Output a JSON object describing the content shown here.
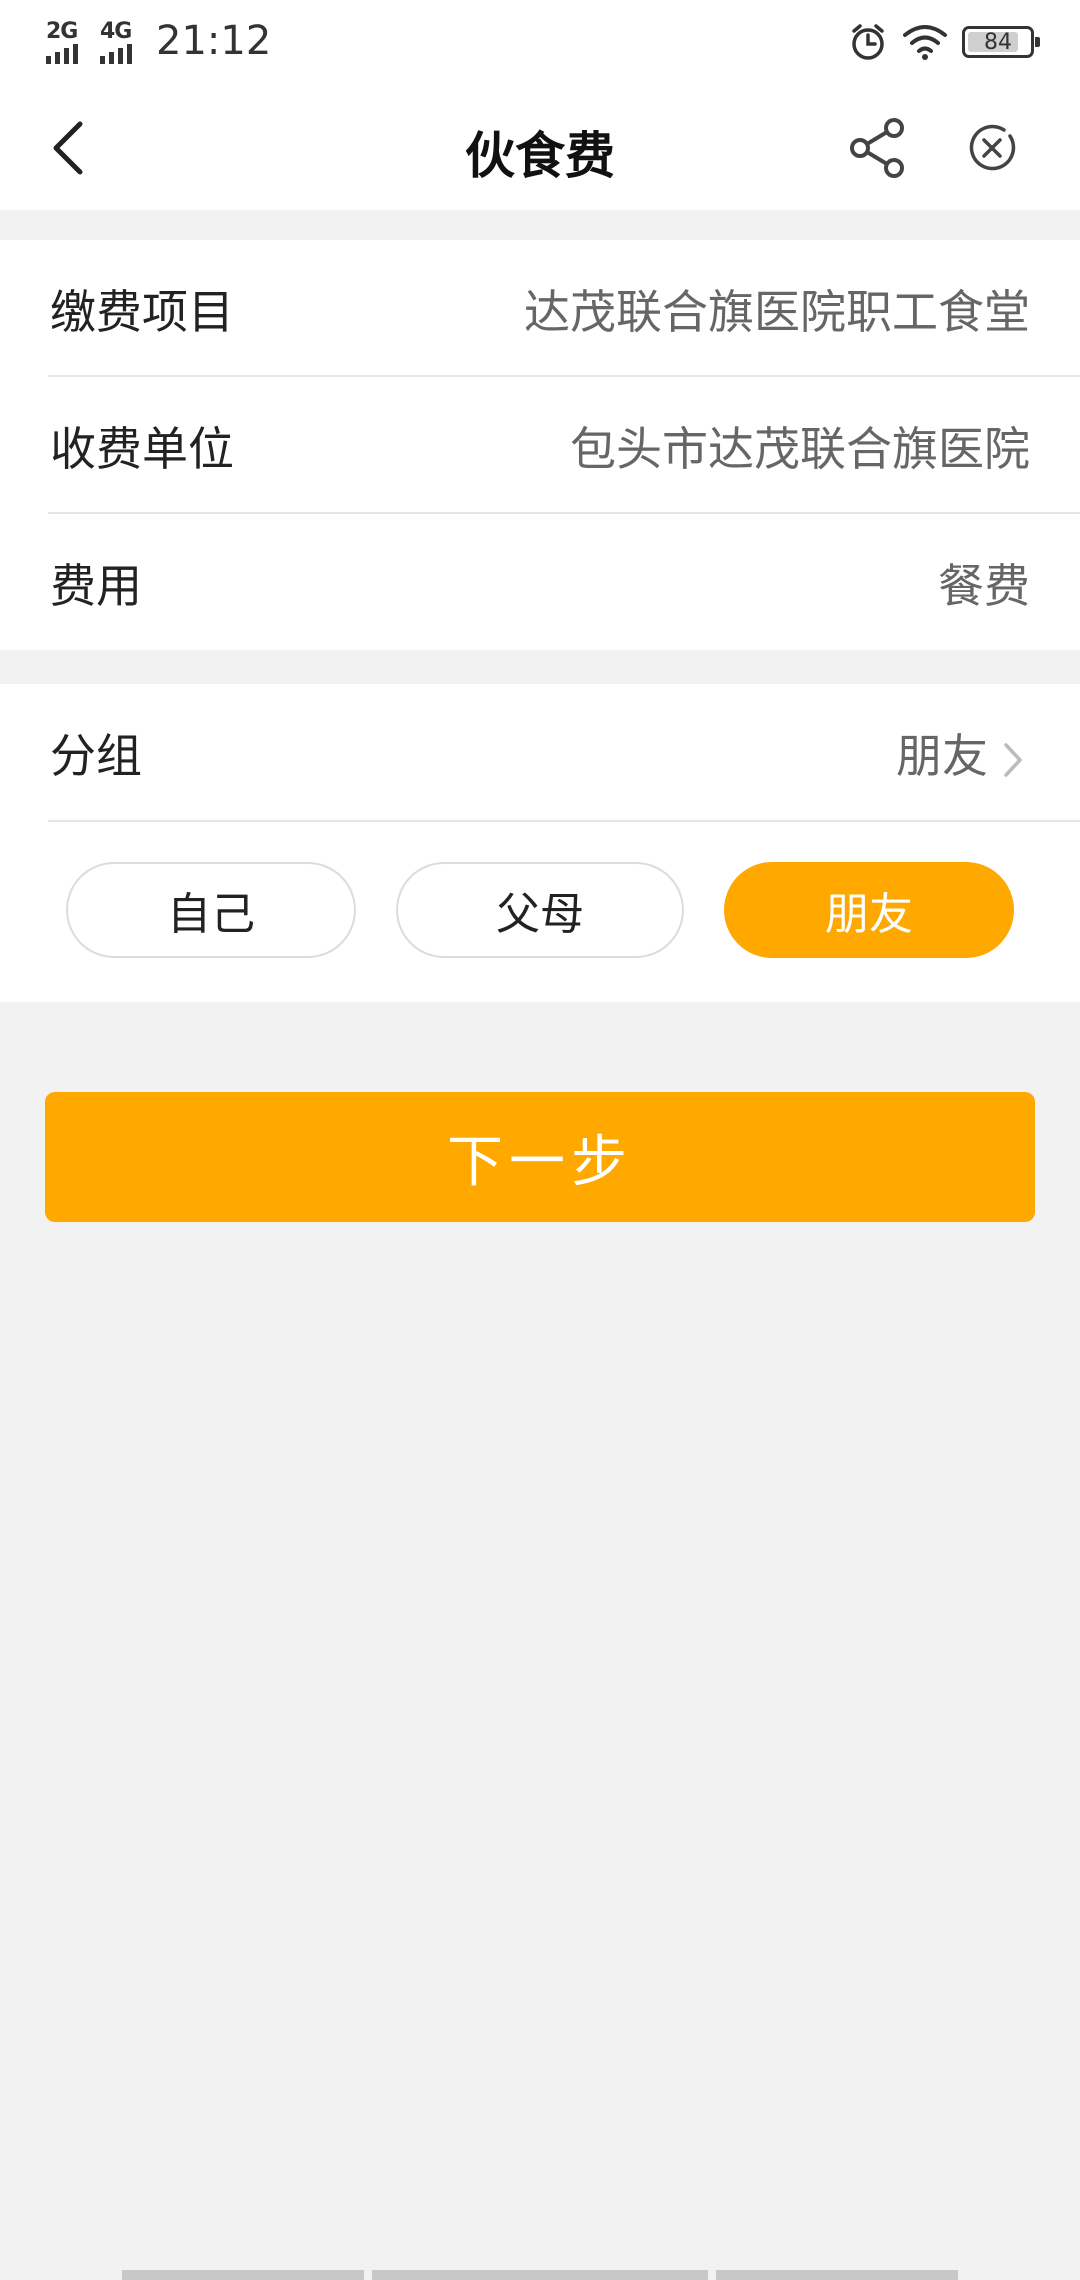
{
  "status_bar": {
    "sim1": "2G",
    "sim2": "4G",
    "time": "21:12",
    "battery": "84",
    "battery_level": 0.84
  },
  "nav": {
    "title": "伙食费"
  },
  "details": [
    {
      "label": "缴费项目",
      "value": "达茂联合旗医院职工食堂"
    },
    {
      "label": "收费单位",
      "value": "包头市达茂联合旗医院"
    },
    {
      "label": "费用",
      "value": "餐费"
    }
  ],
  "group": {
    "label": "分组",
    "selected": "朋友",
    "options": [
      "自己",
      "父母",
      "朋友"
    ]
  },
  "next_button": "下一步",
  "colors": {
    "accent": "#ffa800",
    "background": "#f2f2f2"
  }
}
